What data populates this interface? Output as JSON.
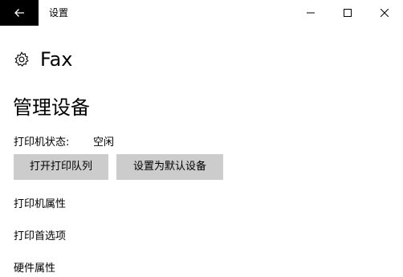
{
  "window": {
    "title": "设置",
    "back_icon": "back-arrow-icon",
    "controls": [
      "minimize-icon",
      "maximize-icon",
      "close-icon"
    ]
  },
  "page": {
    "title": "Fax",
    "icon": "gear-icon"
  },
  "manage": {
    "heading": "管理设备",
    "status_label": "打印机状态:",
    "status_value": "空闲",
    "open_queue_button": "打开打印队列",
    "set_default_button": "设置为默认设备"
  },
  "links": {
    "printer_properties": "打印机属性",
    "printing_preferences": "打印首选项",
    "hardware_properties": "硬件属性"
  },
  "colors": {
    "back_bg": "#000000",
    "button_bg": "#cccccc",
    "background": "#ffffff"
  }
}
